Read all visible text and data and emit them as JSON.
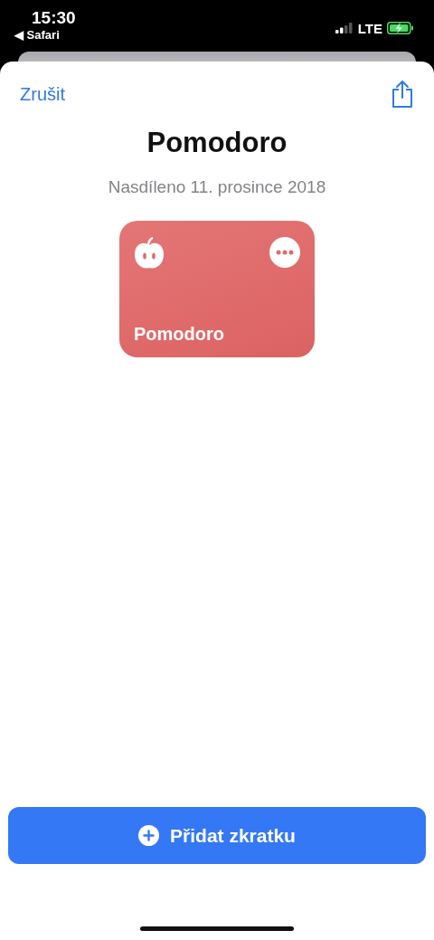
{
  "status_bar": {
    "time": "15:30",
    "back_app": "◀ Safari",
    "network": "LTE"
  },
  "sheet": {
    "cancel": "Zrušit",
    "title": "Pomodoro",
    "subtitle": "Nasdíleno 11. prosince 2018"
  },
  "shortcut_card": {
    "name": "Pomodoro"
  },
  "primary_button": {
    "label": "Přidat zkratku"
  }
}
